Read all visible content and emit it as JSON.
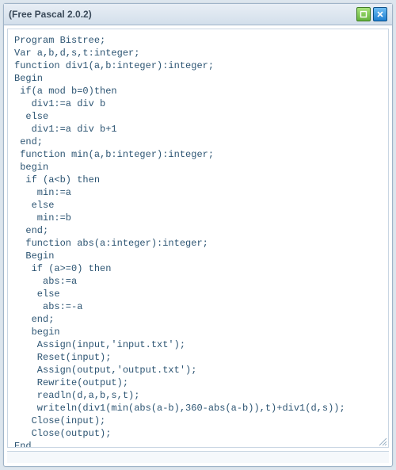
{
  "window": {
    "title": "(Free Pascal 2.0.2)"
  },
  "icons": {
    "minimize": "minimize-icon",
    "close": "close-icon",
    "resize": "resize-grip-icon"
  },
  "code": {
    "lines": [
      "Program Bistree;",
      "Var a,b,d,s,t:integer;",
      "function div1(a,b:integer):integer;",
      "Begin",
      " if(a mod b=0)then",
      "   div1:=a div b",
      "  else",
      "   div1:=a div b+1",
      " end;",
      " function min(a,b:integer):integer;",
      " begin",
      "  if (a<b) then",
      "    min:=a",
      "   else",
      "    min:=b",
      "  end;",
      "  function abs(a:integer):integer;",
      "  Begin",
      "   if (a>=0) then",
      "     abs:=a",
      "    else",
      "     abs:=-a",
      "   end;",
      "   begin",
      "    Assign(input,'input.txt');",
      "    Reset(input);",
      "    Assign(output,'output.txt');",
      "    Rewrite(output);",
      "    readln(d,a,b,s,t);",
      "    writeln(div1(min(abs(a-b),360-abs(a-b)),t)+div1(d,s));",
      "   Close(input);",
      "   Close(output);",
      "End."
    ]
  }
}
